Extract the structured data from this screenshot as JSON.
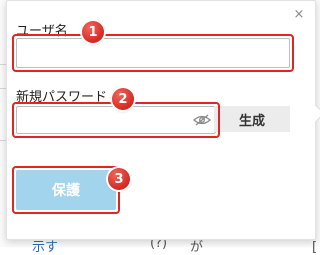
{
  "background": {
    "snippets": [
      {
        "text": "示す",
        "kind": "link"
      },
      {
        "text": "(?)",
        "kind": "text"
      },
      {
        "text": "が",
        "kind": "text"
      },
      {
        "text": "[",
        "kind": "text"
      }
    ]
  },
  "dialog": {
    "close_label": "×",
    "username": {
      "label": "ユーザ名",
      "value": ""
    },
    "password": {
      "label": "新規パスワード",
      "value": ""
    },
    "generate_label": "生成",
    "protect_label": "保護"
  },
  "callouts": [
    "1",
    "2",
    "3"
  ],
  "colors": {
    "callout": "#e12424",
    "protect_button": "#a3d4ee",
    "generate_button": "#ececec"
  },
  "icons": {
    "close": "close-icon",
    "password_visibility": "eye-off-icon"
  }
}
